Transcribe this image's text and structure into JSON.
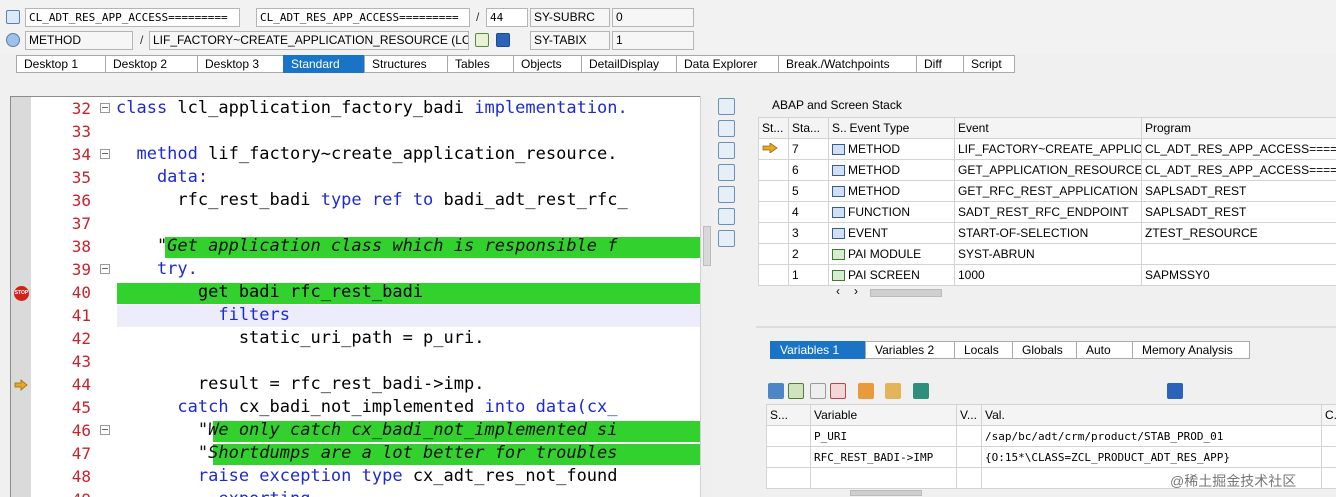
{
  "header": {
    "row1": {
      "field1": "CL_ADT_RES_APP_ACCESS=========",
      "sep1": "/",
      "field2": "CL_ADT_RES_APP_ACCESS=========",
      "sep2": "/",
      "line": "44",
      "sysvar": "SY-SUBRC",
      "sysval": "0"
    },
    "row2": {
      "field1": "METHOD",
      "sep1": "/",
      "field2": "LIF_FACTORY~CREATE_APPLICATION_RESOURCE (LCL...",
      "sysvar": "SY-TABIX",
      "sysval": "1"
    }
  },
  "tabs": [
    "Desktop 1",
    "Desktop 2",
    "Desktop 3",
    "Standard",
    "Structures",
    "Tables",
    "Objects",
    "DetailDisplay",
    "Data Explorer",
    "Break./Watchpoints",
    "Diff",
    "Script"
  ],
  "active_tab": "Standard",
  "editor": {
    "lines": [
      {
        "num": "32",
        "text": [
          "class ",
          "lcl_application_factory_badi ",
          "implementation."
        ]
      },
      {
        "num": "33",
        "text": [
          ""
        ]
      },
      {
        "num": "34",
        "text": [
          "  method ",
          "lif_factory~create_application_resource."
        ]
      },
      {
        "num": "35",
        "text": [
          "    data:"
        ]
      },
      {
        "num": "36",
        "text": [
          "      rfc_rest_badi ",
          "type ref to ",
          "badi_adt_rest_rfc_"
        ]
      },
      {
        "num": "37",
        "text": [
          ""
        ]
      },
      {
        "num": "38",
        "text": [
          "    \"Get application class which is responsible f"
        ]
      },
      {
        "num": "39",
        "text": [
          "    try."
        ]
      },
      {
        "num": "40",
        "text": [
          "        get badi rfc_rest_badi"
        ]
      },
      {
        "num": "41",
        "text": [
          "          filters"
        ]
      },
      {
        "num": "42",
        "text": [
          "            static_uri_path = p_uri."
        ]
      },
      {
        "num": "43",
        "text": [
          ""
        ]
      },
      {
        "num": "44",
        "text": [
          "        result = rfc_rest_badi->imp."
        ]
      },
      {
        "num": "45",
        "text": [
          "      catch ",
          "cx_badi_not_implemented ",
          "into data(cx_"
        ]
      },
      {
        "num": "46",
        "text": [
          "        \"We only catch cx_badi_not_implemented si"
        ]
      },
      {
        "num": "47",
        "text": [
          "        \"Shortdumps are a lot better for troubles"
        ]
      },
      {
        "num": "48",
        "text": [
          "        raise exception type ",
          "cx_adt_res_not_found"
        ]
      },
      {
        "num": "49",
        "text": [
          "          exporting"
        ]
      }
    ]
  },
  "stack": {
    "title": "ABAP and Screen Stack",
    "columns": [
      "St...",
      "Sta...",
      "S...",
      "Event Type",
      "Event",
      "Program"
    ],
    "rows": [
      {
        "level": "7",
        "type": "METHOD",
        "event": "LIF_FACTORY~CREATE_APPLIC...",
        "program": "CL_ADT_RES_APP_ACCESS=====",
        "current": true
      },
      {
        "level": "6",
        "type": "METHOD",
        "event": "GET_APPLICATION_RESOURCE",
        "program": "CL_ADT_RES_APP_ACCESS=====",
        "current": false
      },
      {
        "level": "5",
        "type": "METHOD",
        "event": "GET_RFC_REST_APPLICATION",
        "program": "SAPLSADT_REST",
        "current": false
      },
      {
        "level": "4",
        "type": "FUNCTION",
        "event": "SADT_REST_RFC_ENDPOINT",
        "program": "SAPLSADT_REST",
        "current": false
      },
      {
        "level": "3",
        "type": "EVENT",
        "event": "START-OF-SELECTION",
        "program": "ZTEST_RESOURCE",
        "current": false
      },
      {
        "level": "2",
        "type": "PAI MODULE",
        "event": "SYST-ABRUN",
        "program": "",
        "current": false
      },
      {
        "level": "1",
        "type": "PAI SCREEN",
        "event": "1000",
        "program": "SAPMSSY0",
        "current": false
      }
    ]
  },
  "var_tabs": [
    "Variables 1",
    "Variables 2",
    "Locals",
    "Globals",
    "Auto",
    "Memory Analysis"
  ],
  "active_var_tab": "Variables 1",
  "variables": {
    "columns": [
      "S...",
      "Variable",
      "V...",
      "Val.",
      "C..."
    ],
    "rows": [
      {
        "name": "P_URI",
        "value": "/sap/bc/adt/crm/product/STAB_PROD_01"
      },
      {
        "name": "RFC_REST_BADI->IMP",
        "value": "{O:15*\\CLASS=ZCL_PRODUCT_ADT_RES_APP}"
      }
    ]
  },
  "watermark": "@稀土掘金技术社区"
}
